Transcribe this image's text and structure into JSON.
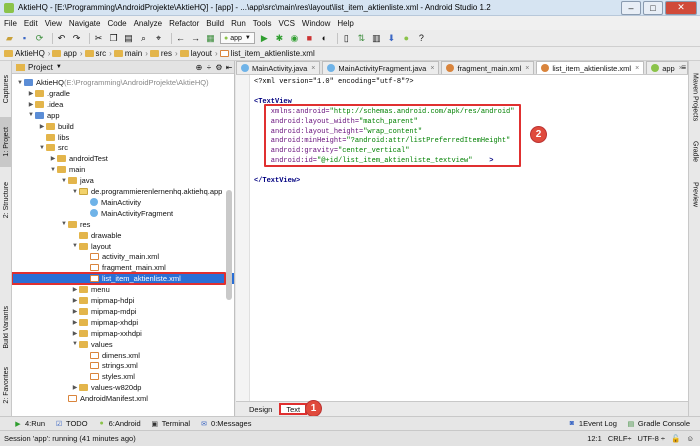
{
  "window": {
    "title": "AktieHQ - [E:\\Programming\\AndroidProjekte\\AktieHQ] - [app] - ...\\app\\src\\main\\res\\layout\\list_item_aktienliste.xml - Android Studio 1.2"
  },
  "menu": [
    "File",
    "Edit",
    "View",
    "Navigate",
    "Code",
    "Analyze",
    "Refactor",
    "Build",
    "Run",
    "Tools",
    "VCS",
    "Window",
    "Help"
  ],
  "toolbar": {
    "run_config": "app"
  },
  "breadcrumbs": [
    "AktieHQ",
    "app",
    "src",
    "main",
    "res",
    "layout",
    "list_item_aktienliste.xml"
  ],
  "left_strip": [
    "Captures",
    "1: Project",
    "2: Structure",
    "Build Variants",
    "2: Favorites"
  ],
  "right_strip": [
    "Maven Projects",
    "Gradle",
    "Preview"
  ],
  "project_panel": {
    "header": "Project",
    "tree": [
      {
        "label": "AktieHQ",
        "suffix": " (E:\\Programming\\AndroidProjekte\\AktieHQ)",
        "depth": 0,
        "open": true,
        "icon": "module"
      },
      {
        "label": ".gradle",
        "depth": 1,
        "open": false,
        "icon": "folder"
      },
      {
        "label": ".idea",
        "depth": 1,
        "open": false,
        "icon": "folder"
      },
      {
        "label": "app",
        "depth": 1,
        "open": true,
        "icon": "module"
      },
      {
        "label": "build",
        "depth": 2,
        "open": false,
        "icon": "folder"
      },
      {
        "label": "libs",
        "depth": 2,
        "open": null,
        "icon": "folder"
      },
      {
        "label": "src",
        "depth": 2,
        "open": true,
        "icon": "folder"
      },
      {
        "label": "androidTest",
        "depth": 3,
        "open": false,
        "icon": "folder"
      },
      {
        "label": "main",
        "depth": 3,
        "open": true,
        "icon": "folder"
      },
      {
        "label": "java",
        "depth": 4,
        "open": true,
        "icon": "folder"
      },
      {
        "label": "de.programmierenlernenhq.aktiehq.app",
        "depth": 5,
        "open": true,
        "icon": "package"
      },
      {
        "label": "MainActivity",
        "depth": 6,
        "open": null,
        "icon": "class"
      },
      {
        "label": "MainActivityFragment",
        "depth": 6,
        "open": null,
        "icon": "class"
      },
      {
        "label": "res",
        "depth": 4,
        "open": true,
        "icon": "res"
      },
      {
        "label": "drawable",
        "depth": 5,
        "open": null,
        "icon": "folder"
      },
      {
        "label": "layout",
        "depth": 5,
        "open": true,
        "icon": "folder"
      },
      {
        "label": "activity_main.xml",
        "depth": 6,
        "open": null,
        "icon": "xml"
      },
      {
        "label": "fragment_main.xml",
        "depth": 6,
        "open": null,
        "icon": "xml"
      },
      {
        "label": "list_item_aktienliste.xml",
        "depth": 6,
        "open": null,
        "icon": "xml",
        "selected": true
      },
      {
        "label": "menu",
        "depth": 5,
        "open": false,
        "icon": "folder"
      },
      {
        "label": "mipmap-hdpi",
        "depth": 5,
        "open": false,
        "icon": "folder"
      },
      {
        "label": "mipmap-mdpi",
        "depth": 5,
        "open": false,
        "icon": "folder"
      },
      {
        "label": "mipmap-xhdpi",
        "depth": 5,
        "open": false,
        "icon": "folder"
      },
      {
        "label": "mipmap-xxhdpi",
        "depth": 5,
        "open": false,
        "icon": "folder"
      },
      {
        "label": "values",
        "depth": 5,
        "open": true,
        "icon": "folder"
      },
      {
        "label": "dimens.xml",
        "depth": 6,
        "open": null,
        "icon": "xml"
      },
      {
        "label": "strings.xml",
        "depth": 6,
        "open": null,
        "icon": "xml"
      },
      {
        "label": "styles.xml",
        "depth": 6,
        "open": null,
        "icon": "xml"
      },
      {
        "label": "values-w820dp",
        "depth": 5,
        "open": false,
        "icon": "folder"
      },
      {
        "label": "AndroidManifest.xml",
        "depth": 4,
        "open": null,
        "icon": "xml"
      }
    ]
  },
  "editor": {
    "tabs": [
      {
        "label": "MainActivity.java",
        "active": false
      },
      {
        "label": "MainActivityFragment.java",
        "active": false
      },
      {
        "label": "fragment_main.xml",
        "active": false
      },
      {
        "label": "list_item_aktienliste.xml",
        "active": true
      },
      {
        "label": "app",
        "active": false
      }
    ],
    "code": [
      {
        "parts": [
          [
            "pi",
            "<?xml version=\"1.0\" encoding=\"utf-8\"?>"
          ]
        ]
      },
      {
        "parts": []
      },
      {
        "parts": [
          [
            "tag",
            "<TextView"
          ]
        ]
      },
      {
        "parts": [
          [
            "attr",
            "    xmlns:android="
          ],
          [
            "val",
            "\"http://schemas.android.com/apk/res/android\""
          ]
        ]
      },
      {
        "parts": [
          [
            "attr",
            "    android:layout_width="
          ],
          [
            "val",
            "\"match_parent\""
          ]
        ]
      },
      {
        "parts": [
          [
            "attr",
            "    android:layout_height="
          ],
          [
            "val",
            "\"wrap_content\""
          ]
        ]
      },
      {
        "parts": [
          [
            "attr",
            "    android:minHeight="
          ],
          [
            "val",
            "\"?android:attr/listPreferredItemHeight\""
          ]
        ]
      },
      {
        "parts": [
          [
            "attr",
            "    android:gravity="
          ],
          [
            "val",
            "\"center_vertical\""
          ]
        ]
      },
      {
        "parts": [
          [
            "attr",
            "    android:id="
          ],
          [
            "val",
            "\"@+id/list_item_aktienliste_textview\""
          ],
          [
            "tag",
            "    >"
          ]
        ]
      },
      {
        "parts": []
      },
      {
        "parts": [
          [
            "tag",
            "</TextView>"
          ]
        ]
      }
    ],
    "bottom_tabs": [
      {
        "label": "Design",
        "active": false
      },
      {
        "label": "Text",
        "active": true
      }
    ],
    "badge1": "1",
    "badge2": "2"
  },
  "tool_windows": [
    {
      "key": "4",
      "label": "Run"
    },
    {
      "key": "",
      "label": "TODO"
    },
    {
      "key": "6",
      "label": "Android"
    },
    {
      "key": "",
      "label": "Terminal"
    },
    {
      "key": "0",
      "label": "Messages"
    }
  ],
  "tool_windows_right": [
    {
      "key": "1",
      "label": "Event Log"
    },
    {
      "key": "",
      "label": "Gradle Console"
    }
  ],
  "status": {
    "message": "Session 'app': running (41 minutes ago)",
    "position": "12:1",
    "line_sep": "CRLF÷",
    "encoding": "UTF-8 ÷"
  }
}
